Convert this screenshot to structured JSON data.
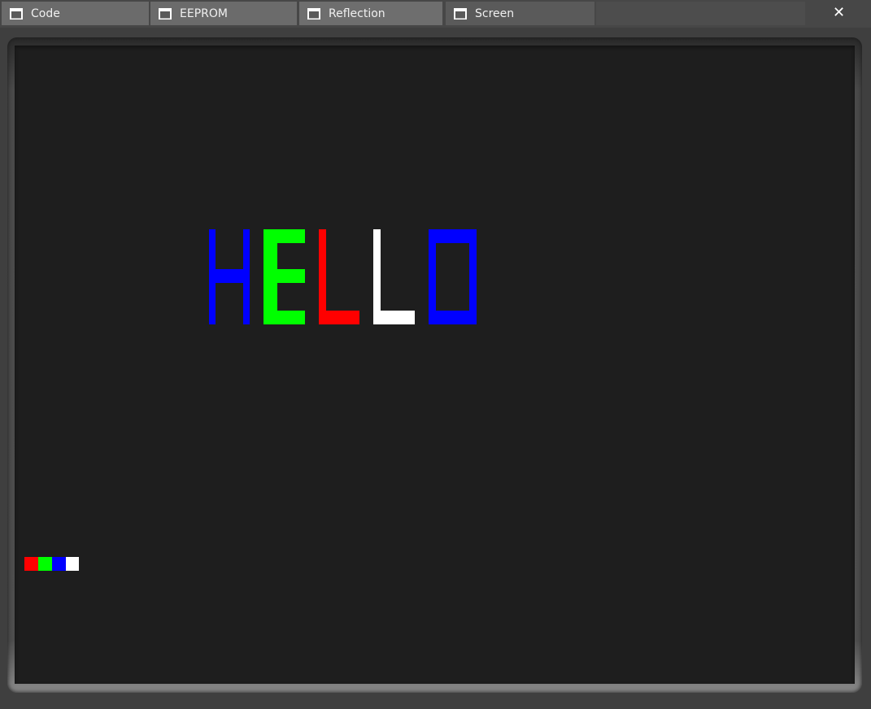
{
  "tabs": [
    {
      "label": "Code",
      "icon": "window-icon"
    },
    {
      "label": "EEPROM",
      "icon": "window-icon"
    },
    {
      "label": "Reflection",
      "icon": "window-icon"
    },
    {
      "label": "Screen",
      "icon": "window-icon",
      "active": true
    }
  ],
  "close_label": "✕",
  "screen": {
    "text": "HELLO",
    "letters": [
      {
        "char": "H",
        "color": "#0000ff"
      },
      {
        "char": "E",
        "color": "#00ff00"
      },
      {
        "char": "L",
        "color": "#ff0000"
      },
      {
        "char": "L",
        "color": "#ffffff"
      },
      {
        "char": "O",
        "color": "#0000ff"
      }
    ],
    "palette": [
      "#ff0000",
      "#00ff00",
      "#0000ff",
      "#ffffff"
    ],
    "background": "#1e1e1e"
  }
}
